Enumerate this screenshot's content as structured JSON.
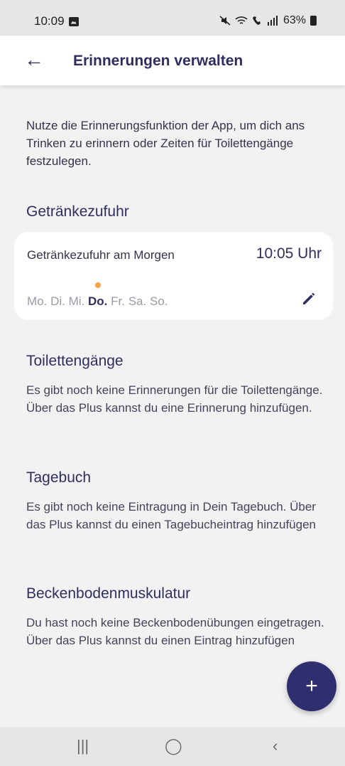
{
  "status_bar": {
    "time": "10:09",
    "battery": "63%"
  },
  "app_bar": {
    "title": "Erinnerungen verwalten"
  },
  "intro": "Nutze die Erinnerungsfunktion der App, um dich ans Trinken zu erinnern oder Zeiten für Toilettengänge festzulegen.",
  "sections": {
    "drinks": {
      "title": "Getränkezufuhr",
      "card": {
        "name": "Getränkezufuhr am Morgen",
        "time": "10:05 Uhr",
        "days": [
          "Mo.",
          "Di.",
          "Mi.",
          "Do.",
          "Fr.",
          "Sa.",
          "So."
        ],
        "active_day": "Do."
      }
    },
    "toilet": {
      "title": "Toilettengänge",
      "text": "Es gibt noch keine Erinnerungen für die Toilettengänge. Über das Plus kannst du eine Erinnerung hinzufügen."
    },
    "diary": {
      "title": "Tagebuch",
      "text": "Es gibt noch keine Eintragung in Dein Tagebuch. Über das Plus kannst du einen Tagebucheintrag hinzufügen"
    },
    "pelvic": {
      "title": "Beckenbodenmuskulatur",
      "text": "Du hast noch keine Beckenbodenübungen eingetragen. Über das Plus kannst du einen Eintrag hinzufügen"
    }
  },
  "fab": {
    "label": "+"
  },
  "colors": {
    "primary": "#2f2e6e",
    "accent": "#f5a442"
  },
  "nav_bar": {
    "recents": "|||",
    "home": "◯",
    "back": "‹"
  }
}
